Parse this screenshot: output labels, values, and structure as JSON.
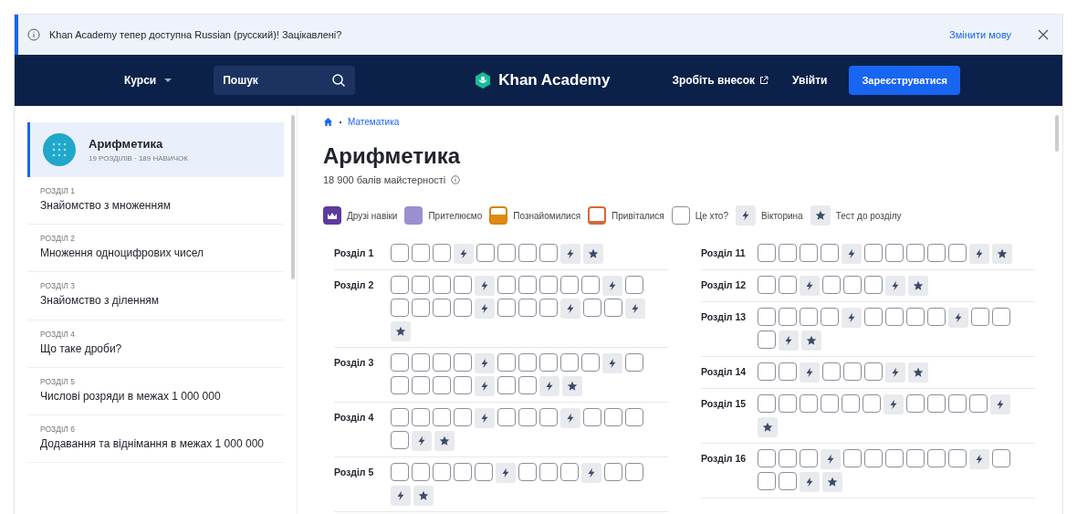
{
  "banner": {
    "message": "Khan Academy тепер доступна Russian (русский)! Зацікавлені?",
    "action": "Змінити мову"
  },
  "nav": {
    "courses": "Курси",
    "search_placeholder": "Пошук",
    "logo": "Khan Academy",
    "donate": "Зробіть внесок",
    "login": "Увійти",
    "signup": "Зареєструватися"
  },
  "sidebar": {
    "course": {
      "title": "Арифметика",
      "meta": "19 РОЗДІЛІВ · 189 НАВИЧОК",
      "selected": true
    },
    "items": [
      {
        "unit": "РОЗДІЛ 1",
        "title": "Знайомство з множенням"
      },
      {
        "unit": "РОЗДІЛ 2",
        "title": "Множення одноцифрових чисел"
      },
      {
        "unit": "РОЗДІЛ 3",
        "title": "Знайомство з діленням"
      },
      {
        "unit": "РОЗДІЛ 4",
        "title": "Що таке дроби?"
      },
      {
        "unit": "РОЗДІЛ 5",
        "title": "Числові розряди в межах 1 000 000"
      },
      {
        "unit": "РОЗДІЛ 6",
        "title": "Додавання та віднімання в межах 1 000 000"
      }
    ]
  },
  "breadcrumb": "Математика",
  "title": "Арифметика",
  "points": "18 900 балів майстерності",
  "legend": [
    {
      "kind": "mastered",
      "label": "Друзі навіки"
    },
    {
      "kind": "proficient",
      "label": "Прителюємо"
    },
    {
      "kind": "familiar",
      "label": "Познайомилися"
    },
    {
      "kind": "attempted",
      "label": "Привіталися"
    },
    {
      "kind": "not_started",
      "label": "Це хто?"
    },
    {
      "kind": "quiz",
      "label": "Вікторина"
    },
    {
      "kind": "unit_test",
      "label": "Тест до розділу"
    }
  ],
  "units_left": [
    {
      "label": "Розділ 1",
      "skills": [
        {
          "kind": "skill"
        },
        {
          "kind": "skill"
        },
        {
          "kind": "skill"
        },
        {
          "kind": "quiz"
        },
        {
          "kind": "skill"
        },
        {
          "kind": "skill"
        },
        {
          "kind": "skill"
        },
        {
          "kind": "skill"
        },
        {
          "kind": "quiz"
        },
        {
          "kind": "unit_test"
        }
      ]
    },
    {
      "label": "Розділ 2",
      "skills": [
        {
          "kind": "skill"
        },
        {
          "kind": "skill"
        },
        {
          "kind": "skill"
        },
        {
          "kind": "skill"
        },
        {
          "kind": "quiz"
        },
        {
          "kind": "skill"
        },
        {
          "kind": "skill"
        },
        {
          "kind": "skill"
        },
        {
          "kind": "skill"
        },
        {
          "kind": "skill"
        },
        {
          "kind": "quiz"
        },
        {
          "kind": "skill"
        },
        {
          "kind": "skill"
        },
        {
          "kind": "skill"
        },
        {
          "kind": "skill"
        },
        {
          "kind": "skill"
        },
        {
          "kind": "quiz"
        },
        {
          "kind": "skill"
        },
        {
          "kind": "skill"
        },
        {
          "kind": "skill"
        },
        {
          "kind": "quiz"
        },
        {
          "kind": "skill"
        },
        {
          "kind": "skill"
        },
        {
          "kind": "quiz"
        },
        {
          "kind": "unit_test"
        }
      ]
    },
    {
      "label": "Розділ 3",
      "skills": [
        {
          "kind": "skill"
        },
        {
          "kind": "skill"
        },
        {
          "kind": "skill"
        },
        {
          "kind": "skill"
        },
        {
          "kind": "quiz"
        },
        {
          "kind": "skill"
        },
        {
          "kind": "skill"
        },
        {
          "kind": "skill"
        },
        {
          "kind": "skill"
        },
        {
          "kind": "skill"
        },
        {
          "kind": "quiz"
        },
        {
          "kind": "skill"
        },
        {
          "kind": "skill"
        },
        {
          "kind": "skill"
        },
        {
          "kind": "skill"
        },
        {
          "kind": "skill"
        },
        {
          "kind": "quiz"
        },
        {
          "kind": "skill"
        },
        {
          "kind": "skill"
        },
        {
          "kind": "quiz"
        },
        {
          "kind": "unit_test"
        }
      ]
    },
    {
      "label": "Розділ 4",
      "skills": [
        {
          "kind": "skill"
        },
        {
          "kind": "skill"
        },
        {
          "kind": "skill"
        },
        {
          "kind": "skill"
        },
        {
          "kind": "quiz"
        },
        {
          "kind": "skill"
        },
        {
          "kind": "skill"
        },
        {
          "kind": "skill"
        },
        {
          "kind": "quiz"
        },
        {
          "kind": "skill"
        },
        {
          "kind": "skill"
        },
        {
          "kind": "skill"
        },
        {
          "kind": "skill"
        },
        {
          "kind": "quiz"
        },
        {
          "kind": "unit_test"
        }
      ]
    },
    {
      "label": "Розділ 5",
      "skills": [
        {
          "kind": "skill"
        },
        {
          "kind": "skill"
        },
        {
          "kind": "skill"
        },
        {
          "kind": "skill"
        },
        {
          "kind": "skill"
        },
        {
          "kind": "quiz"
        },
        {
          "kind": "skill"
        },
        {
          "kind": "skill"
        },
        {
          "kind": "skill"
        },
        {
          "kind": "quiz"
        },
        {
          "kind": "skill"
        },
        {
          "kind": "skill"
        },
        {
          "kind": "quiz"
        },
        {
          "kind": "unit_test"
        }
      ]
    }
  ],
  "units_right": [
    {
      "label": "Розділ 11",
      "skills": [
        {
          "kind": "skill"
        },
        {
          "kind": "skill"
        },
        {
          "kind": "skill"
        },
        {
          "kind": "skill"
        },
        {
          "kind": "quiz"
        },
        {
          "kind": "skill"
        },
        {
          "kind": "skill"
        },
        {
          "kind": "skill"
        },
        {
          "kind": "skill"
        },
        {
          "kind": "skill"
        },
        {
          "kind": "quiz"
        },
        {
          "kind": "unit_test"
        }
      ]
    },
    {
      "label": "Розділ 12",
      "skills": [
        {
          "kind": "skill"
        },
        {
          "kind": "skill"
        },
        {
          "kind": "quiz"
        },
        {
          "kind": "skill"
        },
        {
          "kind": "skill"
        },
        {
          "kind": "skill"
        },
        {
          "kind": "quiz"
        },
        {
          "kind": "unit_test"
        }
      ]
    },
    {
      "label": "Розділ 13",
      "skills": [
        {
          "kind": "skill"
        },
        {
          "kind": "skill"
        },
        {
          "kind": "skill"
        },
        {
          "kind": "skill"
        },
        {
          "kind": "quiz"
        },
        {
          "kind": "skill"
        },
        {
          "kind": "skill"
        },
        {
          "kind": "skill"
        },
        {
          "kind": "skill"
        },
        {
          "kind": "quiz"
        },
        {
          "kind": "skill"
        },
        {
          "kind": "skill"
        },
        {
          "kind": "skill"
        },
        {
          "kind": "quiz"
        },
        {
          "kind": "unit_test"
        }
      ]
    },
    {
      "label": "Розділ 14",
      "skills": [
        {
          "kind": "skill"
        },
        {
          "kind": "skill"
        },
        {
          "kind": "quiz"
        },
        {
          "kind": "skill"
        },
        {
          "kind": "skill"
        },
        {
          "kind": "skill"
        },
        {
          "kind": "quiz"
        },
        {
          "kind": "unit_test"
        }
      ]
    },
    {
      "label": "Розділ 15",
      "skills": [
        {
          "kind": "skill"
        },
        {
          "kind": "skill"
        },
        {
          "kind": "skill"
        },
        {
          "kind": "skill"
        },
        {
          "kind": "skill"
        },
        {
          "kind": "skill"
        },
        {
          "kind": "quiz"
        },
        {
          "kind": "skill"
        },
        {
          "kind": "skill"
        },
        {
          "kind": "skill"
        },
        {
          "kind": "skill"
        },
        {
          "kind": "quiz"
        },
        {
          "kind": "unit_test"
        }
      ]
    },
    {
      "label": "Розділ 16",
      "skills": [
        {
          "kind": "skill"
        },
        {
          "kind": "skill"
        },
        {
          "kind": "skill"
        },
        {
          "kind": "quiz"
        },
        {
          "kind": "skill"
        },
        {
          "kind": "skill"
        },
        {
          "kind": "skill"
        },
        {
          "kind": "skill"
        },
        {
          "kind": "skill"
        },
        {
          "kind": "skill"
        },
        {
          "kind": "quiz"
        },
        {
          "kind": "skill"
        },
        {
          "kind": "skill"
        },
        {
          "kind": "skill"
        },
        {
          "kind": "quiz"
        },
        {
          "kind": "unit_test"
        }
      ]
    }
  ]
}
